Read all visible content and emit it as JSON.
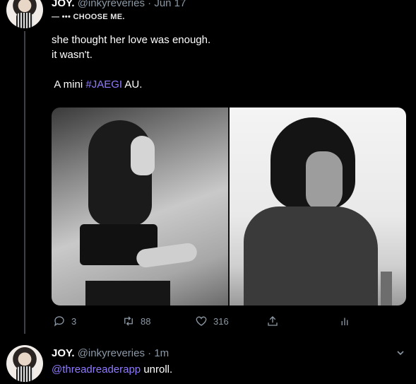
{
  "tweet1": {
    "author_name": "JOY.",
    "author_handle": "@inkyreveries",
    "date": "Jun 17",
    "subtitle": "— ••• CHOOSE ME.",
    "text_line1": "she thought her love was enough.",
    "text_line2": "it wasn't.",
    "text_line3_pre": " A mini ",
    "hashtag": "#JAEGI",
    "text_line3_post": " AU.",
    "actions": {
      "reply_count": "3",
      "retweet_count": "88",
      "like_count": "316"
    }
  },
  "tweet2": {
    "author_name": "JOY.",
    "author_handle": "@inkyreveries",
    "time": "1m",
    "mention": "@threadreaderapp",
    "text_rest": " unroll."
  },
  "colors": {
    "background": "#000000",
    "text_primary": "#ffffff",
    "text_secondary": "#8b98a5",
    "accent": "#8f7bff"
  },
  "icons": {
    "reply": "reply-icon",
    "retweet": "retweet-icon",
    "like": "heart-icon",
    "share": "share-icon",
    "analytics": "analytics-icon",
    "menu": "chevron-down-icon"
  }
}
